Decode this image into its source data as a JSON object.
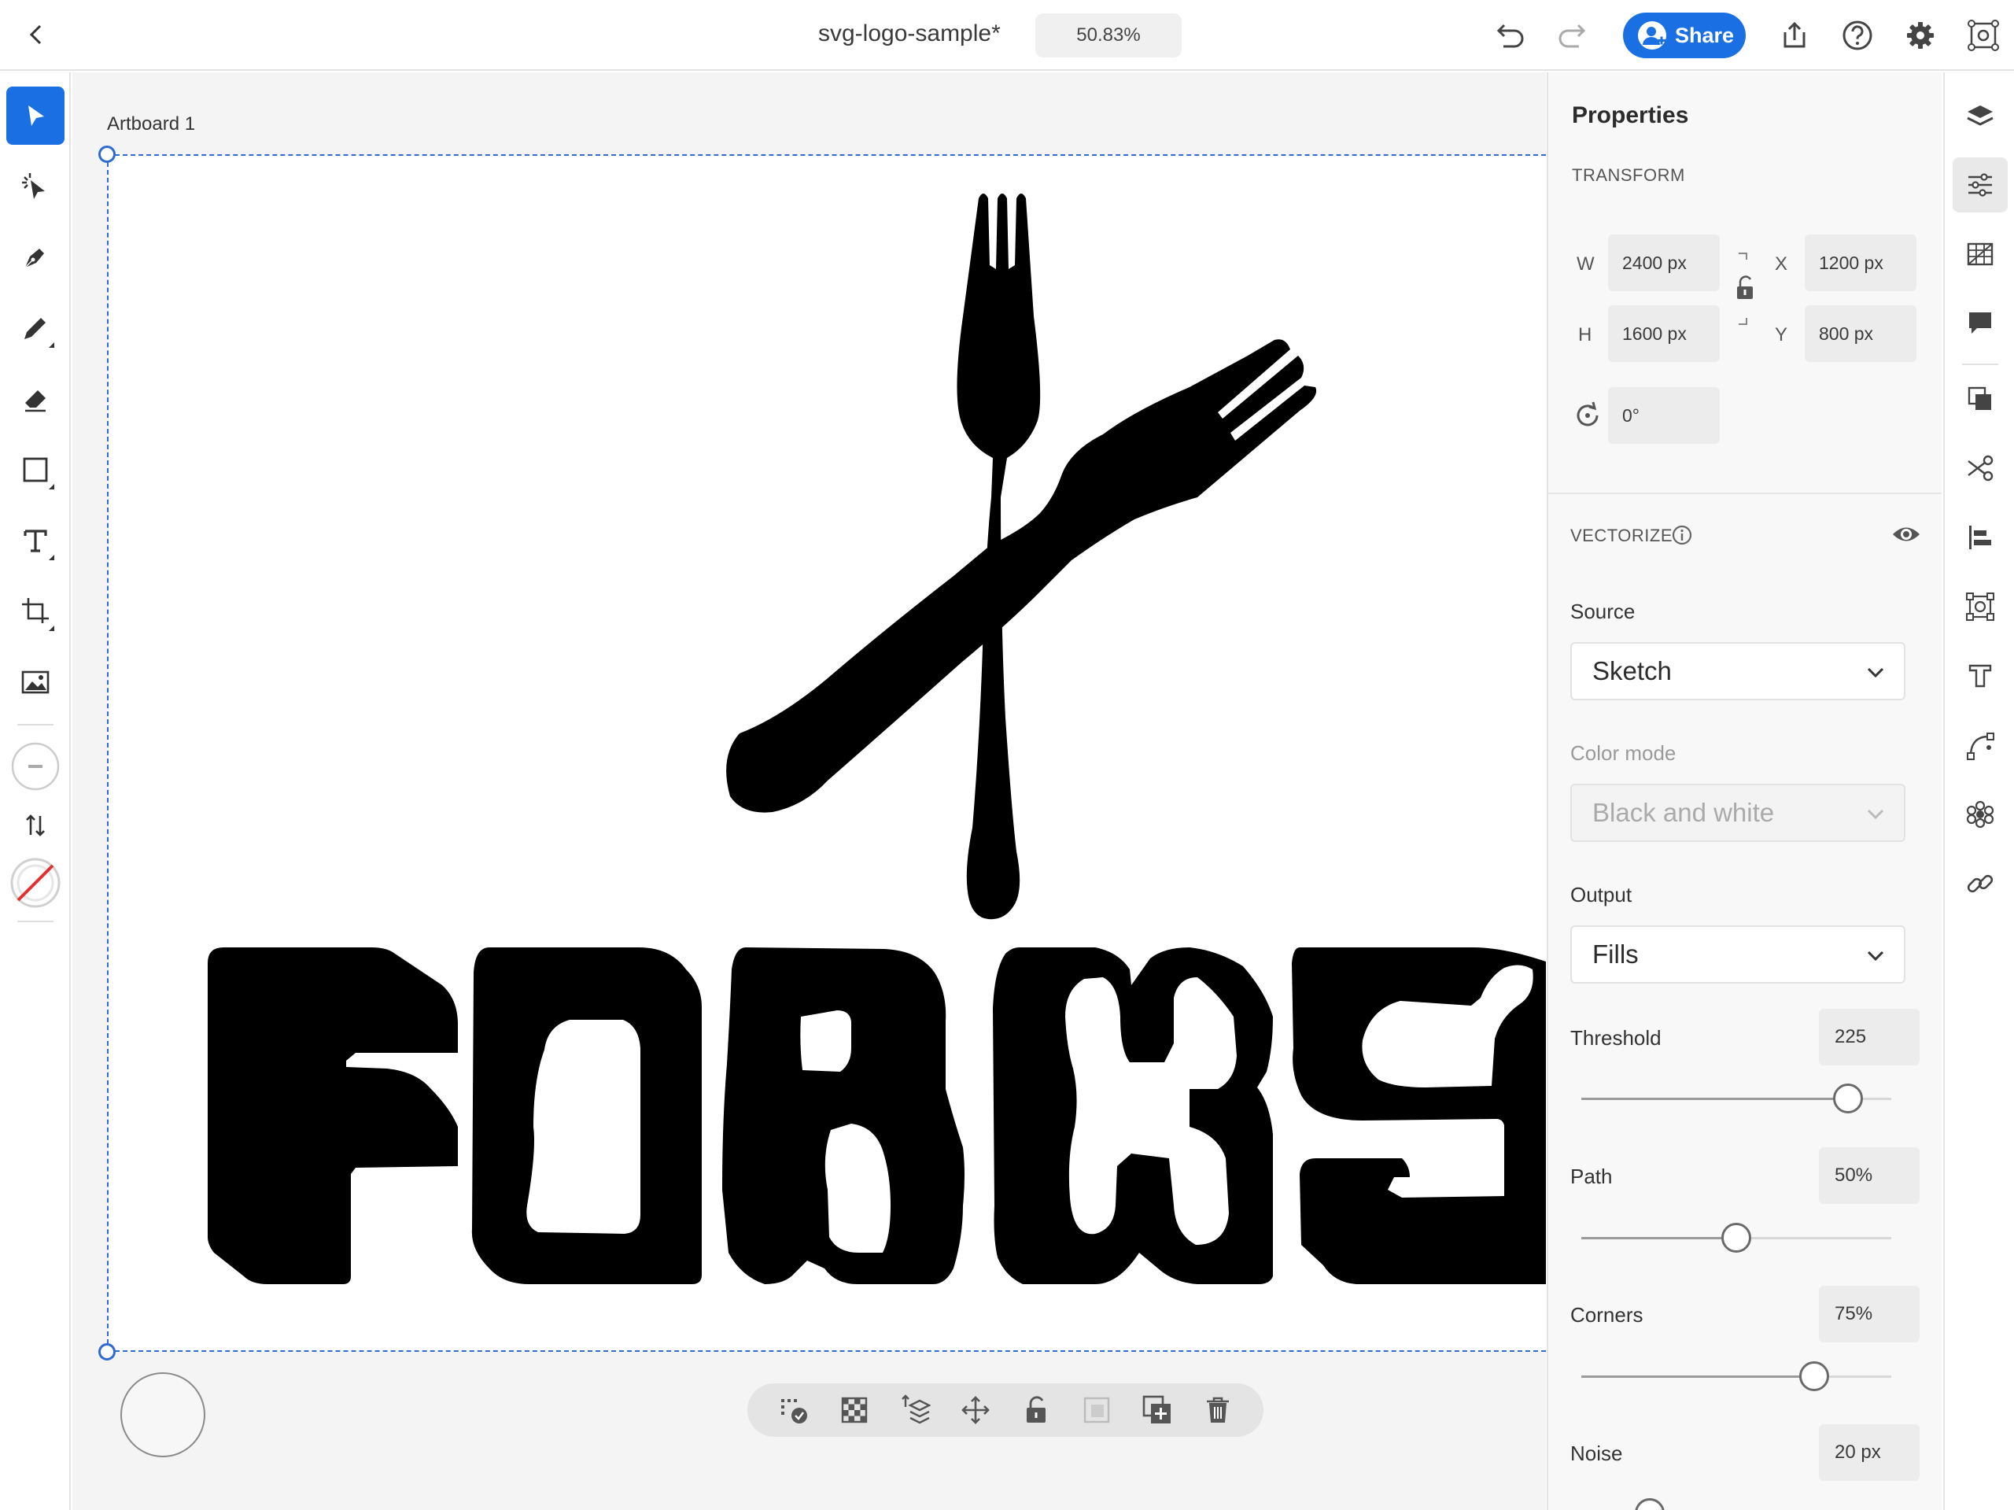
{
  "topbar": {
    "doc_title": "svg-logo-sample*",
    "zoom": "50.83%",
    "share_label": "Share"
  },
  "left_toolbar": {
    "tools": [
      "select-icon",
      "magic-select-icon",
      "pen-icon",
      "pencil-icon",
      "eraser-icon",
      "rectangle-icon",
      "text-icon",
      "crop-icon",
      "image-icon"
    ],
    "active_tool": "select-icon"
  },
  "canvas": {
    "artboard_label": "Artboard 1",
    "logo_text": "FORKS",
    "selection_color": "#2f6bd1"
  },
  "properties": {
    "title": "Properties",
    "transform": {
      "label": "TRANSFORM",
      "w_label": "W",
      "w": "2400 px",
      "h_label": "H",
      "h": "1600 px",
      "x_label": "X",
      "x": "1200 px",
      "y_label": "Y",
      "y": "800 px",
      "rotation": "0°"
    },
    "vectorize": {
      "label": "VECTORIZE",
      "source_label": "Source",
      "source": "Sketch",
      "color_mode_label": "Color mode",
      "color_mode": "Black and white",
      "output_label": "Output",
      "output": "Fills",
      "threshold_label": "Threshold",
      "threshold": "225",
      "threshold_pct": 0.86,
      "path_label": "Path",
      "path": "50%",
      "path_pct": 0.5,
      "corners_label": "Corners",
      "corners": "75%",
      "corners_pct": 0.75,
      "noise_label": "Noise",
      "noise": "20 px"
    }
  },
  "accent_color": "#1a6fe3"
}
